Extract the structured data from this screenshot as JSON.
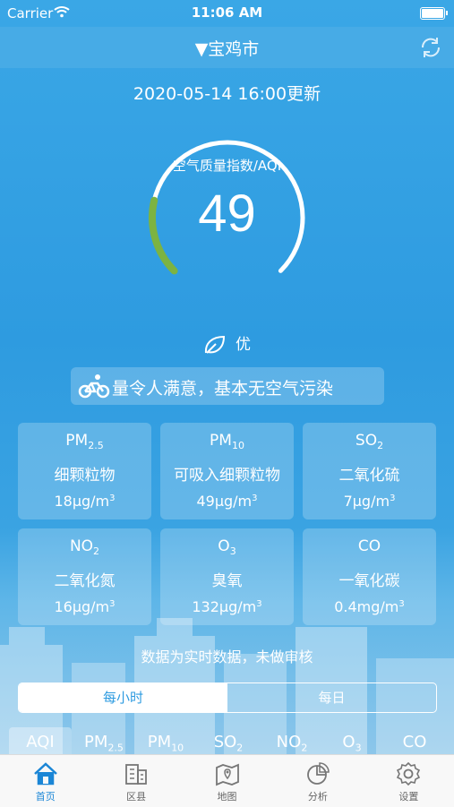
{
  "status_bar": {
    "carrier": "Carrier",
    "time": "11:06 AM"
  },
  "header": {
    "city": "▼宝鸡市"
  },
  "update_time": "2020-05-14 16:00更新",
  "gauge": {
    "label": "空气质量指数/AQI",
    "value": "49",
    "fraction": 0.098
  },
  "level": "优",
  "advice": "量令人满意，基本无空气污染",
  "pollutants": [
    {
      "sym": "PM",
      "sub": "2.5",
      "name": "细颗粒物",
      "value": "18μg/m",
      "sup": "3"
    },
    {
      "sym": "PM",
      "sub": "10",
      "name": "可吸入细颗粒物",
      "value": "49μg/m",
      "sup": "3"
    },
    {
      "sym": "SO",
      "sub": "2",
      "name": "二氧化硫",
      "value": "7μg/m",
      "sup": "3"
    },
    {
      "sym": "NO",
      "sub": "2",
      "name": "二氧化氮",
      "value": "16μg/m",
      "sup": "3"
    },
    {
      "sym": "O",
      "sub": "3",
      "name": "臭氧",
      "value": "132μg/m",
      "sup": "3"
    },
    {
      "sym": "CO",
      "sub": "",
      "name": "一氧化碳",
      "value": "0.4mg/m",
      "sup": "3"
    }
  ],
  "notice": "数据为实时数据，未做审核",
  "segment": {
    "hourly": "每小时",
    "daily": "每日"
  },
  "pollutant_tabs": [
    {
      "sym": "AQI",
      "sub": ""
    },
    {
      "sym": "PM",
      "sub": "2.5"
    },
    {
      "sym": "PM",
      "sub": "10"
    },
    {
      "sym": "SO",
      "sub": "2"
    },
    {
      "sym": "NO",
      "sub": "2"
    },
    {
      "sym": "O",
      "sub": "3"
    },
    {
      "sym": "CO",
      "sub": ""
    }
  ],
  "tabbar": [
    {
      "label": "首页",
      "icon": "home-icon"
    },
    {
      "label": "区县",
      "icon": "buildings-icon"
    },
    {
      "label": "地图",
      "icon": "map-icon"
    },
    {
      "label": "分析",
      "icon": "pie-chart-icon"
    },
    {
      "label": "设置",
      "icon": "gear-icon"
    }
  ],
  "colors": {
    "accent": "#1b86d6",
    "gauge_fill": "#7cb342",
    "background": "#2e9be0"
  }
}
